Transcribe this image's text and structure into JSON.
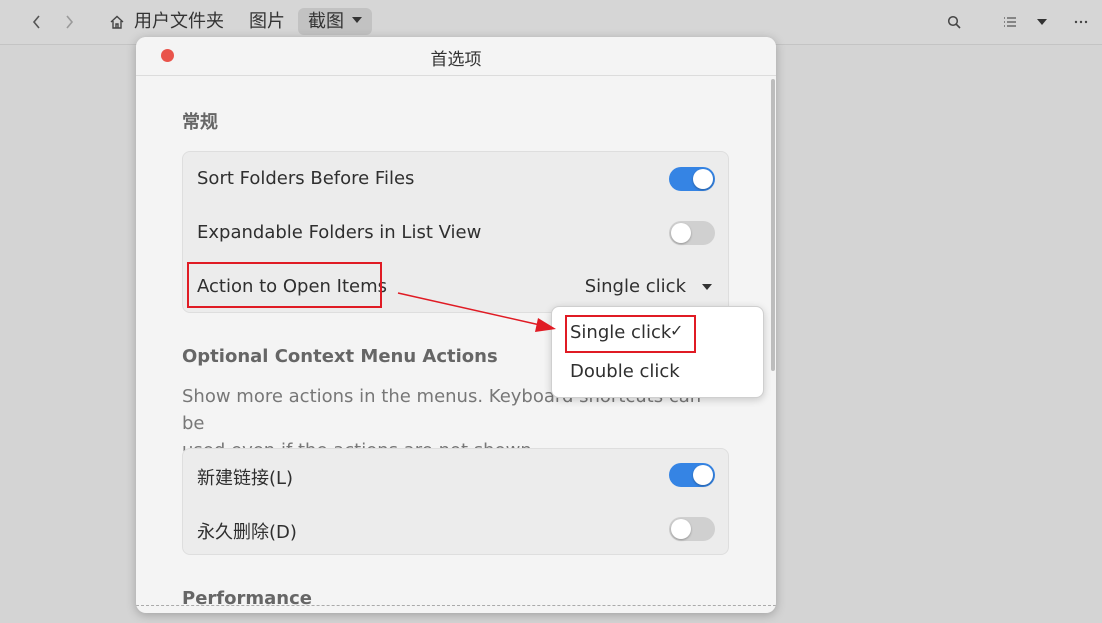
{
  "headerbar": {
    "breadcrumbs": [
      "用户文件夹",
      "图片",
      "截图"
    ],
    "icons": {
      "back": "chevron-left-icon",
      "forward": "chevron-right-icon",
      "home": "home-icon",
      "search": "search-icon",
      "view": "list-view-icon",
      "view_menu": "chevron-down-icon",
      "more": "more-icon"
    }
  },
  "dialog": {
    "title": "首选项",
    "general": {
      "heading": "常规",
      "rows": [
        {
          "label": "Sort Folders Before Files",
          "toggle": true
        },
        {
          "label": "Expandable Folders in List View",
          "toggle": false
        },
        {
          "label": "Action to Open Items",
          "value": "Single click"
        }
      ]
    },
    "context_menu": {
      "heading": "Optional Context Menu Actions",
      "description_line1": "Show more actions in the menus. Keyboard shortcuts can be",
      "description_line2": "used even if the actions are not shown.",
      "rows": [
        {
          "label": "新建链接(L)",
          "toggle": true
        },
        {
          "label": "永久删除(D)",
          "toggle": false
        }
      ]
    },
    "performance": {
      "heading": "Performance"
    }
  },
  "popover": {
    "options": [
      "Single click",
      "Double click"
    ],
    "selected": "Single click",
    "check_glyph": "✓"
  },
  "colors": {
    "accent": "#3584e4",
    "close": "#e9544b",
    "annotation": "#e01b24"
  }
}
